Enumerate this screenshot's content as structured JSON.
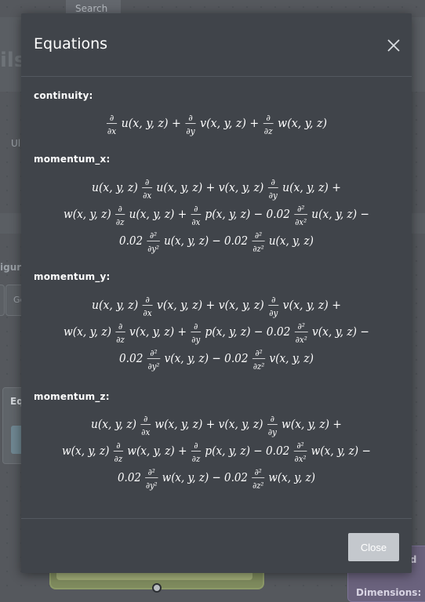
{
  "background": {
    "search_label": "Search",
    "fragment_ils": "ils",
    "fragment_ul": "Ul",
    "fragment_igura": "igura",
    "fragment_ge": "Ge",
    "fragment_eq": "Eq",
    "fragment_ond": "ond",
    "fragment_dimensions": "Dimensions:"
  },
  "modal": {
    "title": "Equations",
    "close_button": "Close",
    "equations": [
      {
        "label": "continuity:",
        "lines": [
          "∂/∂x u(x, y, z) + ∂/∂y v(x, y, z) + ∂/∂z w(x, y, z)"
        ]
      },
      {
        "label": "momentum_x:",
        "lines": [
          "u(x, y, z) ∂/∂x u(x, y, z) + v(x, y, z) ∂/∂y u(x, y, z) +",
          "w(x, y, z) ∂/∂z u(x, y, z) + ∂/∂x p(x, y, z) − 0.02 ∂²/∂x² u(x, y, z) −",
          "0.02 ∂²/∂y² u(x, y, z) − 0.02 ∂²/∂z² u(x, y, z)"
        ]
      },
      {
        "label": "momentum_y:",
        "lines": [
          "u(x, y, z) ∂/∂x v(x, y, z) + v(x, y, z) ∂/∂y v(x, y, z) +",
          "w(x, y, z) ∂/∂z v(x, y, z) + ∂/∂y p(x, y, z) − 0.02 ∂²/∂x² v(x, y, z) −",
          "0.02 ∂²/∂y² v(x, y, z) − 0.02 ∂²/∂z² v(x, y, z)"
        ]
      },
      {
        "label": "momentum_z:",
        "lines": [
          "u(x, y, z) ∂/∂x w(x, y, z) + v(x, y, z) ∂/∂y w(x, y, z) +",
          "w(x, y, z) ∂/∂z w(x, y, z) + ∂/∂z p(x, y, z) − 0.02 ∂²/∂x² w(x, y, z) −",
          "0.02 ∂²/∂y² w(x, y, z) − 0.02 ∂²/∂z² w(x, y, z)"
        ]
      }
    ]
  },
  "colors": {
    "backdrop": "#55585d",
    "modal_bg": "#40444a",
    "button_bg": "#c4c8cd",
    "text": "#ffffff"
  },
  "icons": {
    "close": "close-icon"
  }
}
